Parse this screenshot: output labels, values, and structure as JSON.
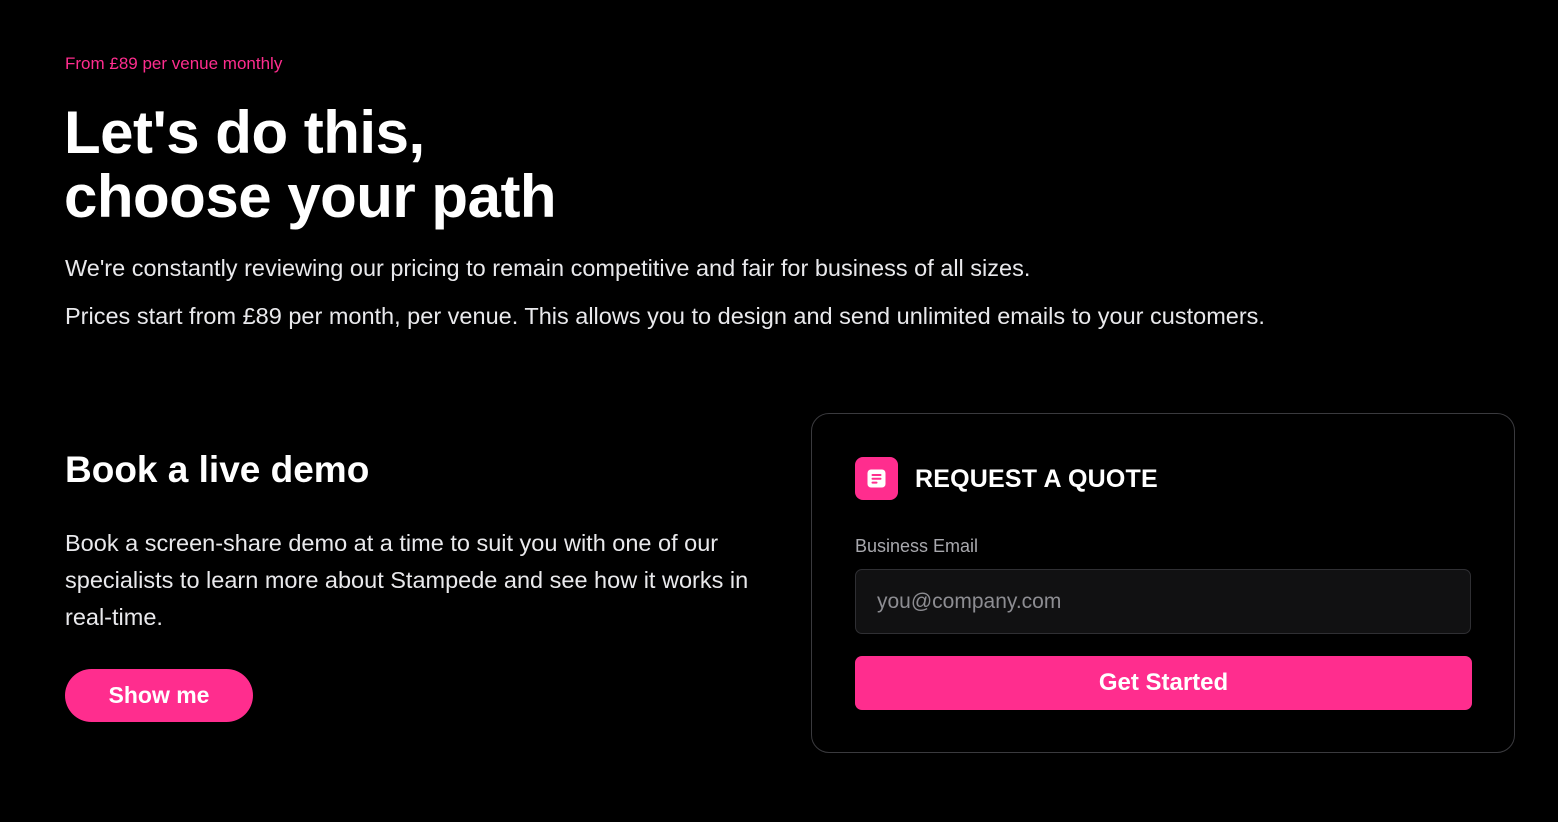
{
  "hero": {
    "eyebrow": "From £89 per venue monthly",
    "headline_line1": "Let's do this,",
    "headline_line2": "choose your path",
    "paragraph1": "We're constantly reviewing our pricing to remain competitive and fair for business of all sizes.",
    "paragraph2": "Prices start from £89 per month, per venue. This allows you to design and send unlimited emails to your customers."
  },
  "demo": {
    "title": "Book a live demo",
    "description": "Book a screen-share demo at a time to suit you with one of our specialists to learn more about Stampede and see how it works in real-time.",
    "button_label": "Show me"
  },
  "quote": {
    "icon": "document-icon",
    "title": "REQUEST A QUOTE",
    "email_label": "Business Email",
    "email_value": "",
    "email_placeholder": "you@company.com",
    "submit_label": "Get Started"
  },
  "colors": {
    "background": "#000000",
    "accent": "#ff2d8e",
    "text": "#ffffff",
    "muted": "#a8a8ad"
  }
}
